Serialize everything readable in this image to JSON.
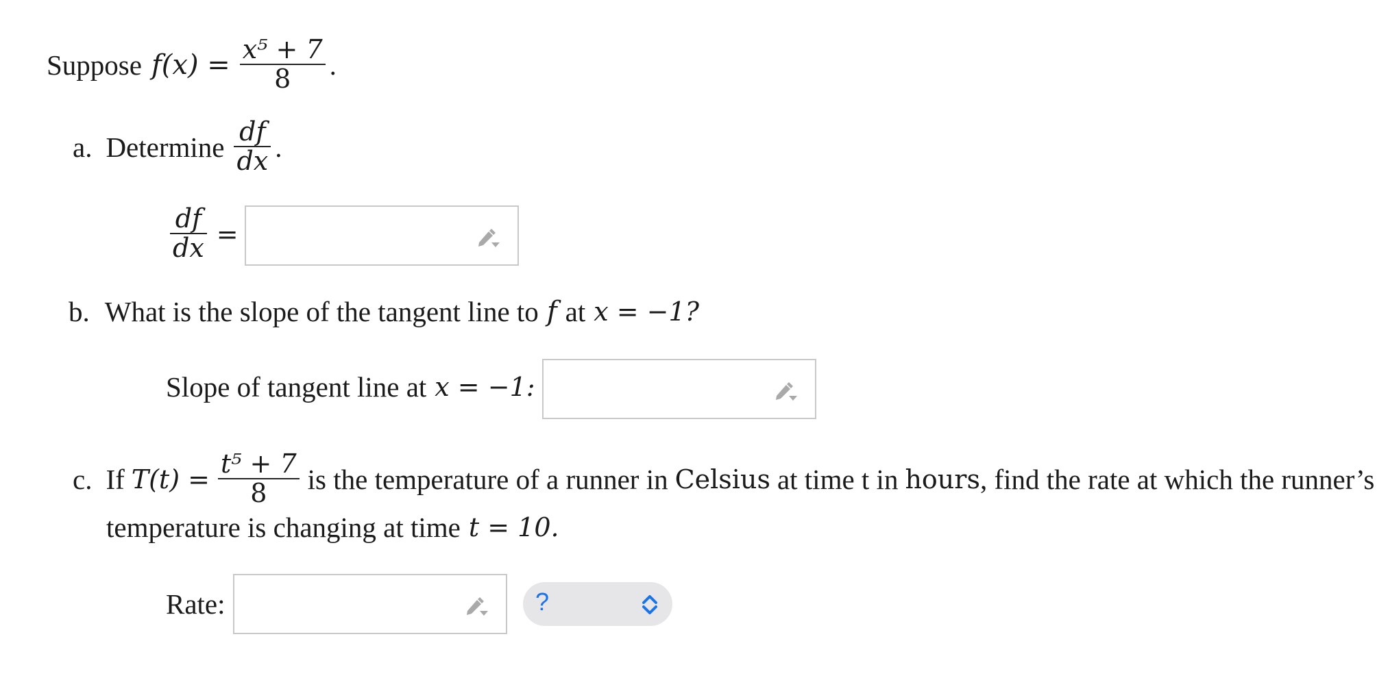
{
  "problem": {
    "intro_word": "Suppose",
    "f_lhs": "f(x) =",
    "f_num": "x⁵ + 7",
    "f_den": "8",
    "f_end": "."
  },
  "part_a": {
    "marker": "a.",
    "text": "Determine",
    "frac_num": "df",
    "frac_den": "dx",
    "end": ".",
    "answer_label_num": "df",
    "answer_label_den": "dx",
    "answer_eq": "=",
    "answer_value": ""
  },
  "part_b": {
    "marker": "b.",
    "text_1": "What is the slope of the tangent line to",
    "f": "f",
    "text_2": "at",
    "cond": "x = −1?",
    "answer_label": "Slope of tangent line at",
    "answer_cond": "x = −1:",
    "answer_value": ""
  },
  "part_c": {
    "marker": "c.",
    "text_if": "If",
    "T_lhs": "T(t) =",
    "T_num": "t⁵ + 7",
    "T_den": "8",
    "text_1": "is the temperature of a runner in",
    "unit_1": "Celsius",
    "text_2": "at time t in",
    "unit_2": "hours",
    "text_3": ", find the rate at which the runner’s",
    "text_4": "temperature is changing at time",
    "cond": "t = 10.",
    "answer_label": "Rate:",
    "answer_value": "",
    "units_select_value": "?"
  },
  "icons": {
    "pencil": "pencil-dropdown-icon",
    "select": "up-down-chevron-icon"
  },
  "colors": {
    "input_border": "#c8c8c8",
    "pencil": "#a9a9a9",
    "select_bg": "#e6e6e8",
    "select_accent": "#1a73e8"
  }
}
